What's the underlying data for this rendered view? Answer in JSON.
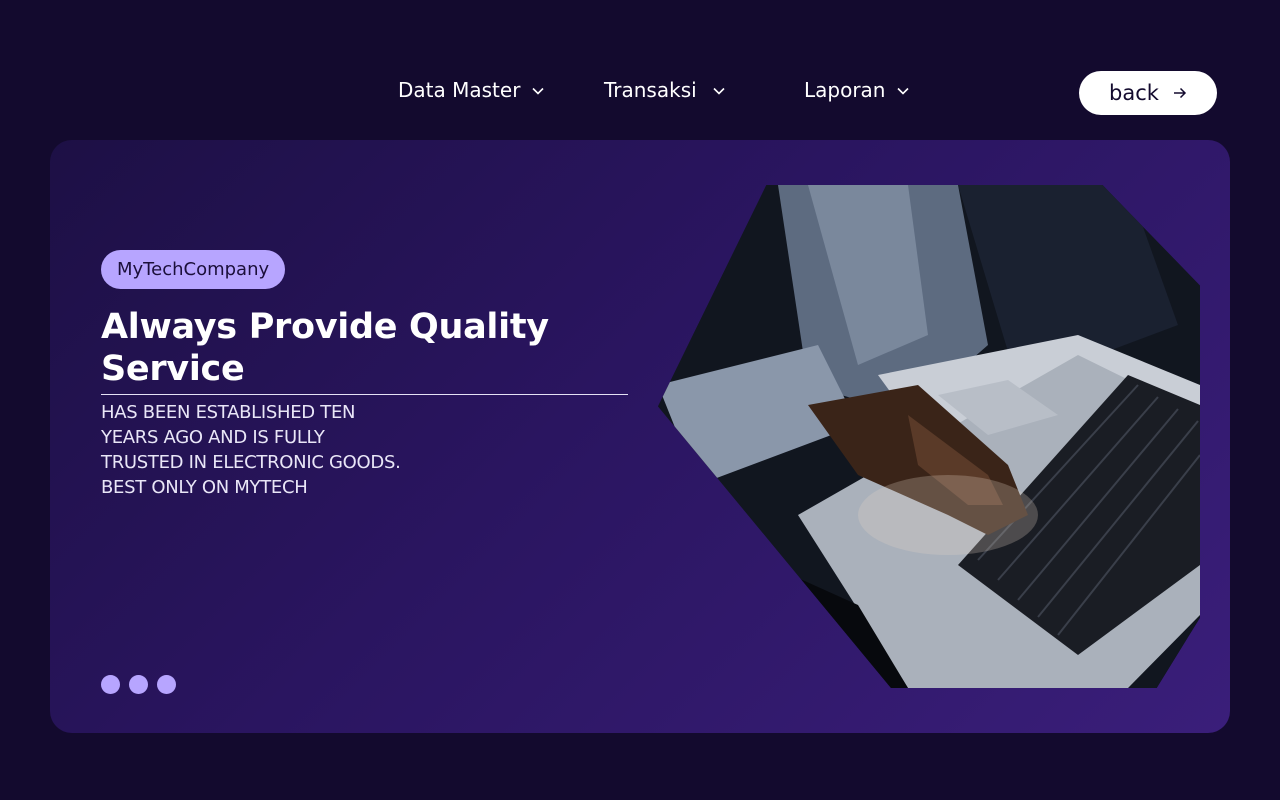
{
  "nav": {
    "items": [
      {
        "label": "Data Master"
      },
      {
        "label": "Transaksi"
      },
      {
        "label": "Laporan"
      }
    ],
    "back_label": "back"
  },
  "hero": {
    "badge": "MyTechCompany",
    "headline": "Always Provide Quality Service",
    "description": "HAS BEEN ESTABLISHED TEN YEARS AGO AND IS FULLY TRUSTED IN ELECTRONIC GOODS. BEST ONLY ON MYTECH",
    "slides": 3
  },
  "colors": {
    "background": "#130a2e",
    "accent": "#b7a5ff",
    "hero_start": "#1d1045",
    "hero_end": "#3a1e7a"
  }
}
